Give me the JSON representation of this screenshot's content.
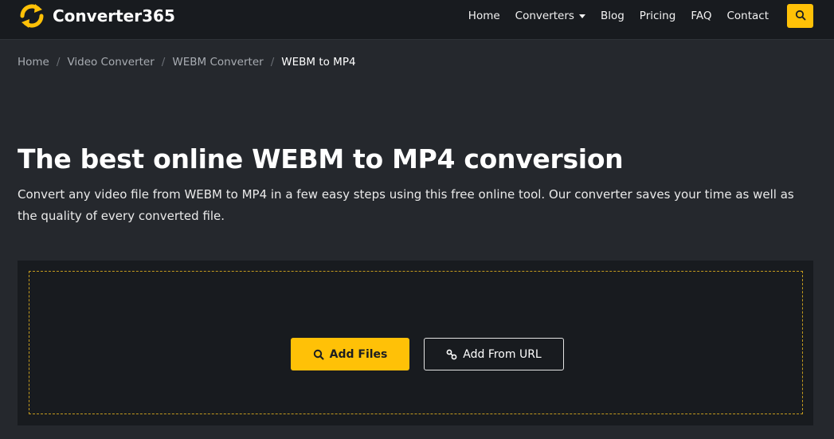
{
  "brand": {
    "name": "Converter365",
    "logo_icon": "sync-arrows-icon",
    "accent_color": "#ffc107"
  },
  "nav": {
    "items": [
      {
        "label": "Home"
      },
      {
        "label": "Converters",
        "has_dropdown": true
      },
      {
        "label": "Blog"
      },
      {
        "label": "Pricing"
      },
      {
        "label": "FAQ"
      },
      {
        "label": "Contact"
      }
    ],
    "search_icon": "search-icon"
  },
  "breadcrumb": {
    "items": [
      {
        "label": "Home"
      },
      {
        "label": "Video Converter"
      },
      {
        "label": "WEBM Converter"
      },
      {
        "label": "WEBM to MP4"
      }
    ],
    "separator": "/"
  },
  "hero": {
    "title": "The best online WEBM to MP4 conversion",
    "description": "Convert any video file from WEBM to MP4 in a few easy steps using this free online tool. Our converter saves your time as well as the quality of every converted file."
  },
  "upload": {
    "add_files_label": "Add Files",
    "add_files_icon": "search-icon",
    "add_url_label": "Add From URL",
    "add_url_icon": "link-icon"
  }
}
